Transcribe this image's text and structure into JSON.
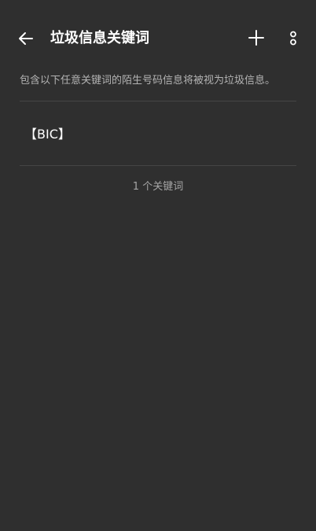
{
  "toolbar": {
    "back_icon": "arrow-left-icon",
    "title": "垃圾信息关键词",
    "add_icon": "plus-icon",
    "more_icon": "vertical-dots-icon"
  },
  "description": "包含以下任意关键词的陌生号码信息将被视为垃圾信息。",
  "keywords": [
    {
      "text": "【BIC】"
    }
  ],
  "keyword_count": "1 个关键词",
  "colors": {
    "background": "#2f2f2f",
    "primary_text": "#ffffff",
    "secondary_text": "#b3b3b3",
    "divider": "#454545"
  }
}
